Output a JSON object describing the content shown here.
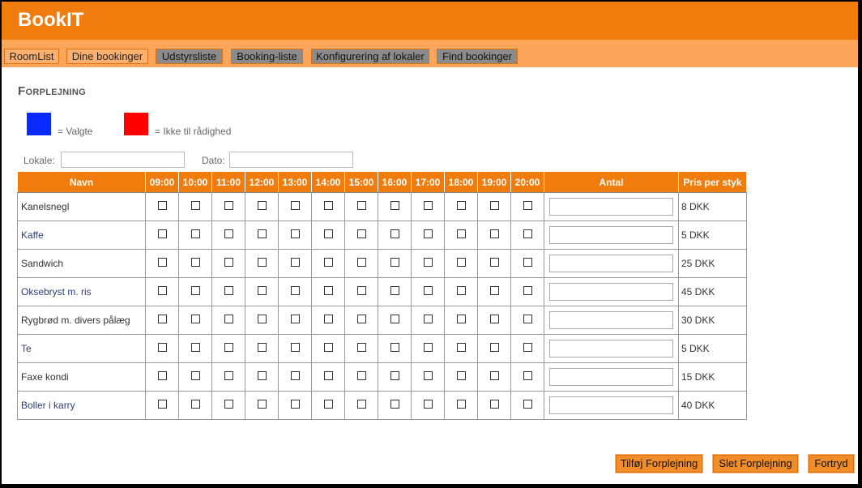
{
  "app": {
    "title": "BookIT"
  },
  "nav": {
    "items": [
      {
        "label": "RoomList"
      },
      {
        "label": "Dine bookinger"
      },
      {
        "label": "Udstyrsliste"
      },
      {
        "label": "Booking-liste"
      },
      {
        "label": "Konfigurering af lokaler"
      },
      {
        "label": "Find bookinger"
      }
    ]
  },
  "page": {
    "title": "Forplejning"
  },
  "legend": {
    "selected": {
      "label": "= Valgte",
      "color": "#0a2bff"
    },
    "unavailable": {
      "label": "= Ikke til rådighed",
      "color": "#ff0000"
    }
  },
  "filters": {
    "lokale_label": "Lokale:",
    "lokale_value": "",
    "dato_label": "Dato:",
    "dato_value": ""
  },
  "table": {
    "headers": {
      "name": "Navn",
      "times": [
        "09:00",
        "10:00",
        "11:00",
        "12:00",
        "13:00",
        "14:00",
        "15:00",
        "16:00",
        "17:00",
        "18:00",
        "19:00",
        "20:00"
      ],
      "antal": "Antal",
      "price": "Pris per styk"
    },
    "rows": [
      {
        "name": "Kanelsnegl",
        "price": "8 DKK"
      },
      {
        "name": "Kaffe",
        "price": "5 DKK"
      },
      {
        "name": "Sandwich",
        "price": "25 DKK"
      },
      {
        "name": "Oksebryst m. ris",
        "price": "45 DKK"
      },
      {
        "name": "Rygbrød m. divers pålæg",
        "price": "30 DKK"
      },
      {
        "name": "Te",
        "price": "5 DKK"
      },
      {
        "name": "Faxe kondi",
        "price": "15 DKK"
      },
      {
        "name": "Boller i karry",
        "price": "40 DKK"
      }
    ]
  },
  "actions": {
    "add": "Tilføj Forplejning",
    "delete": "Slet Forplejning",
    "cancel": "Fortryd"
  },
  "colors": {
    "accent": "#f07c0d",
    "nav_bg": "#fba65a"
  }
}
